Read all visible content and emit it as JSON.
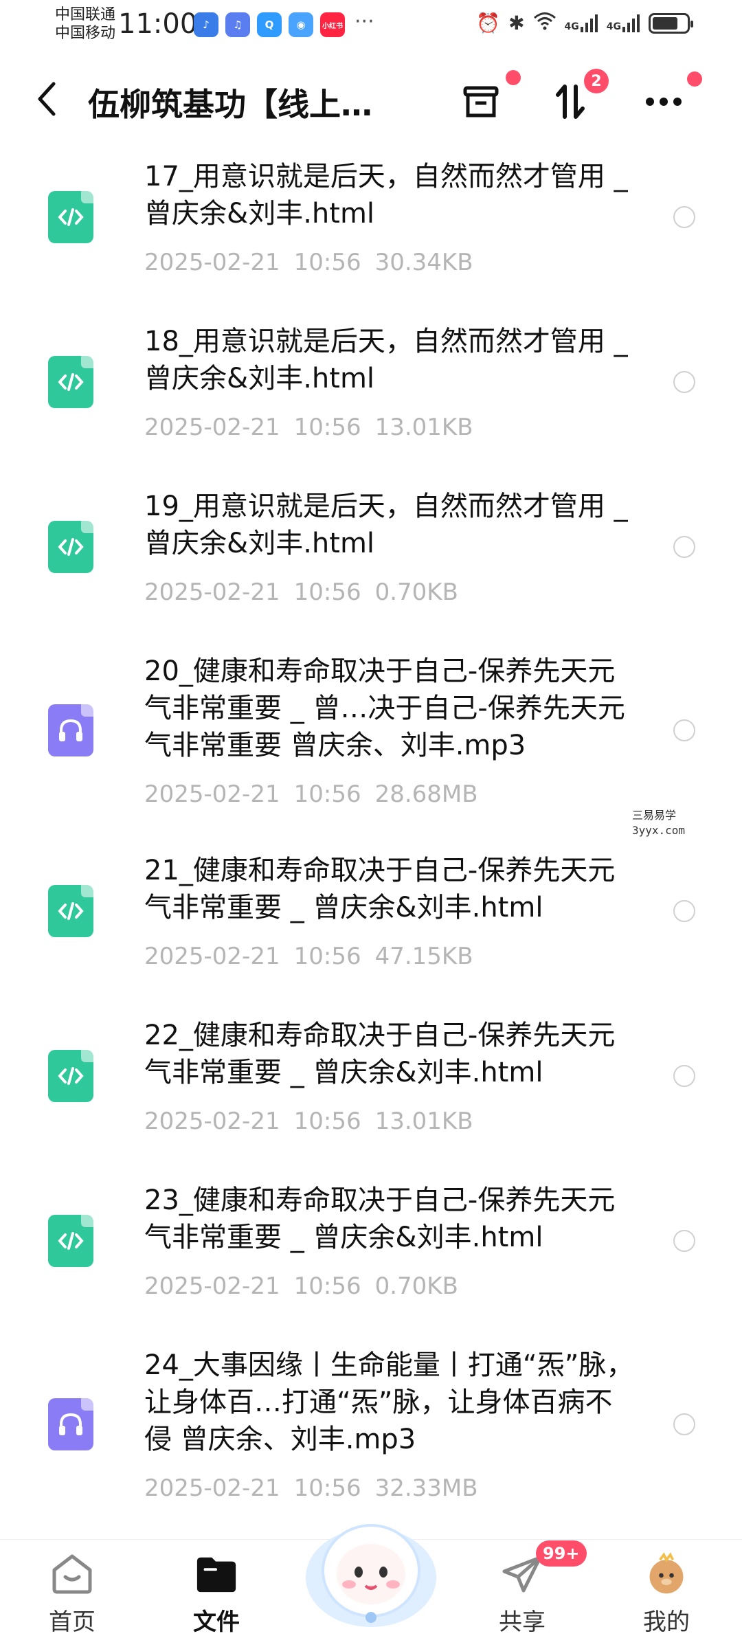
{
  "status_bar": {
    "carrier_1": "中国联通",
    "carrier_2": "中国移动",
    "time": "11:00",
    "apps": [
      {
        "name": "qq-music",
        "label": "♪",
        "color": "#3b7de8"
      },
      {
        "name": "music",
        "label": "♫",
        "color": "#5a7df0"
      },
      {
        "name": "search",
        "label": "Q",
        "color": "#2f9bff"
      },
      {
        "name": "browser",
        "label": "◉",
        "color": "#4aa3ff"
      },
      {
        "name": "xiaohongshu",
        "label": "小红书",
        "color": "#ff2442"
      }
    ],
    "network_1": "4G",
    "network_2": "4G",
    "battery_level": 0.75
  },
  "header": {
    "back_icon": "chevron-left-icon",
    "title": "伍柳筑基功【线上…",
    "sort_badge": "2"
  },
  "files": [
    {
      "type": "code",
      "name": "17_用意识就是后天，自然而然才管用 _ 曾庆余&刘丰.html",
      "date": "2025-02-21",
      "time": "10:56",
      "size": "30.34KB"
    },
    {
      "type": "code",
      "name": "18_用意识就是后天，自然而然才管用 _ 曾庆余&刘丰.html",
      "date": "2025-02-21",
      "time": "10:56",
      "size": "13.01KB"
    },
    {
      "type": "code",
      "name": "19_用意识就是后天，自然而然才管用 _ 曾庆余&刘丰.html",
      "date": "2025-02-21",
      "time": "10:56",
      "size": "0.70KB"
    },
    {
      "type": "audio",
      "name": "20_健康和寿命取决于自己-保养先天元气非常重要 _ 曾…决于自己-保养先天元气非常重要  曾庆余、刘丰.mp3",
      "date": "2025-02-21",
      "time": "10:56",
      "size": "28.68MB"
    },
    {
      "type": "code",
      "name": "21_健康和寿命取决于自己-保养先天元气非常重要 _ 曾庆余&刘丰.html",
      "date": "2025-02-21",
      "time": "10:56",
      "size": "47.15KB"
    },
    {
      "type": "code",
      "name": "22_健康和寿命取决于自己-保养先天元气非常重要 _ 曾庆余&刘丰.html",
      "date": "2025-02-21",
      "time": "10:56",
      "size": "13.01KB"
    },
    {
      "type": "code",
      "name": "23_健康和寿命取决于自己-保养先天元气非常重要 _ 曾庆余&刘丰.html",
      "date": "2025-02-21",
      "time": "10:56",
      "size": "0.70KB"
    },
    {
      "type": "audio",
      "name": "24_大事因缘丨生命能量丨打通“炁”脉，让身体百…打通“炁”脉，让身体百病不侵  曾庆余、刘丰.mp3",
      "date": "2025-02-21",
      "time": "10:56",
      "size": "32.33MB"
    }
  ],
  "watermark": {
    "line1": "三易易学",
    "line2": "3yyx.com"
  },
  "bottom_nav": {
    "home": "首页",
    "files": "文件",
    "share": "共享",
    "mine": "我的",
    "share_badge": "99+"
  }
}
